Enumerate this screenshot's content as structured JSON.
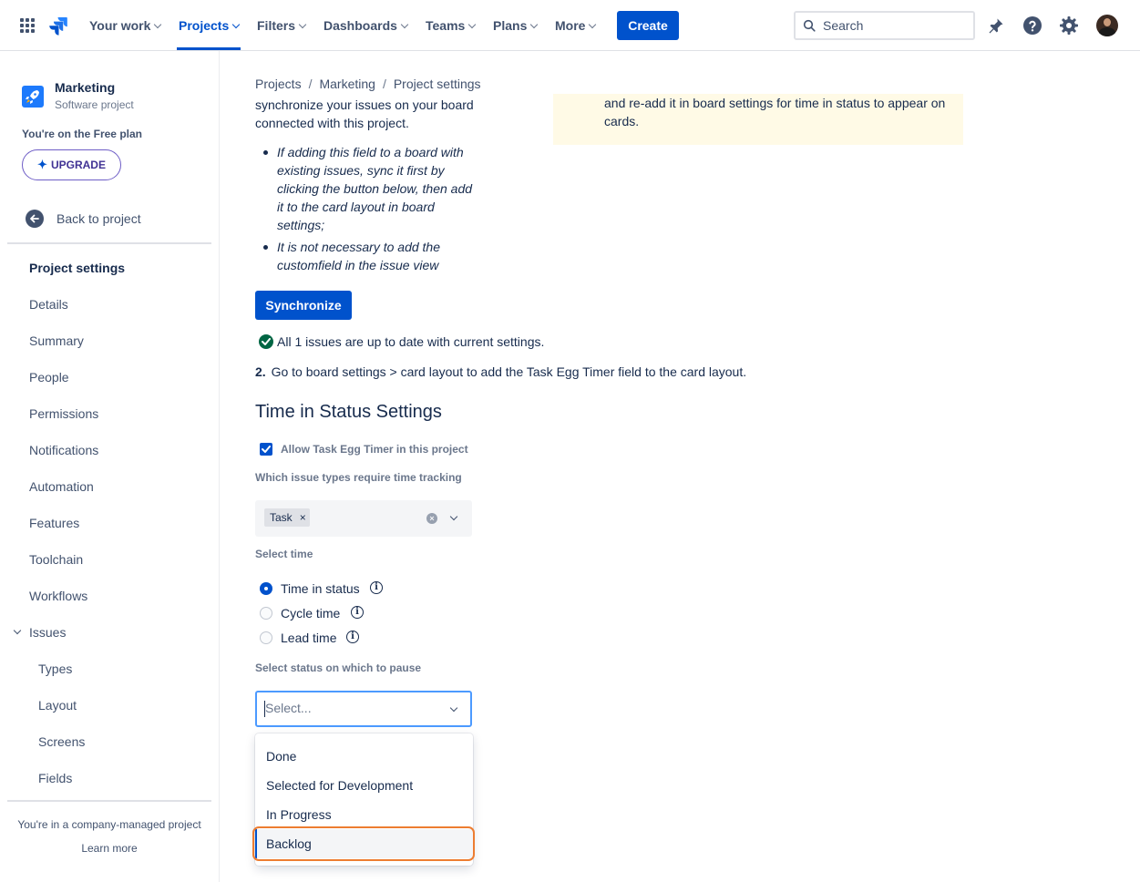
{
  "topnav": {
    "items": [
      {
        "label": "Your work"
      },
      {
        "label": "Projects"
      },
      {
        "label": "Filters"
      },
      {
        "label": "Dashboards"
      },
      {
        "label": "Teams"
      },
      {
        "label": "Plans"
      },
      {
        "label": "More"
      }
    ],
    "active_item": "Projects",
    "create_label": "Create",
    "search_placeholder": "Search",
    "accent_color": "#0052cc"
  },
  "sidebar": {
    "project_name": "Marketing",
    "project_type": "Software project",
    "plan_text": "You're on the Free plan",
    "upgrade_label": "UPGRADE",
    "back_label": "Back to project",
    "section_title": "Project settings",
    "items": [
      "Details",
      "Summary",
      "People",
      "Permissions",
      "Notifications",
      "Automation",
      "Features",
      "Toolchain",
      "Workflows"
    ],
    "issues_label": "Issues",
    "issues_sub": [
      "Types",
      "Layout",
      "Screens",
      "Fields"
    ],
    "footer_text": "You're in a company-managed project",
    "learn_more": "Learn more"
  },
  "breadcrumb": [
    "Projects",
    "Marketing",
    "Project settings"
  ],
  "warning": {
    "text": "and re-add it in board settings for time in status to appear on cards."
  },
  "content": {
    "intro": "synchronize your issues on your board connected with this project.",
    "bullets": [
      "If adding this field to a board with existing issues, sync it first by clicking the button below, then add it to the card layout in board settings;",
      "It is not necessary to add the customfield in the issue view"
    ],
    "sync_label": "Synchronize",
    "status_text": "All 1 issues are up to date with current settings.",
    "step2_num": "2.",
    "step2_text": "Go to board settings > card layout to add the Task Egg Timer field to the card layout."
  },
  "time_in_status": {
    "title": "Time in Status Settings",
    "allow_label": "Allow Task Egg Timer in this project",
    "allow_checked": true,
    "issue_types_label": "Which issue types require time tracking",
    "issue_types_selected": [
      "Task"
    ],
    "select_time_label": "Select time",
    "time_options": [
      "Time in status",
      "Cycle time",
      "Lead time"
    ],
    "time_selected": "Time in status",
    "pause_label": "Select status on which to pause",
    "pause_placeholder": "Select...",
    "pause_options": [
      "Done",
      "Selected for Development",
      "In Progress",
      "Backlog"
    ],
    "hovered_option": "Backlog"
  }
}
